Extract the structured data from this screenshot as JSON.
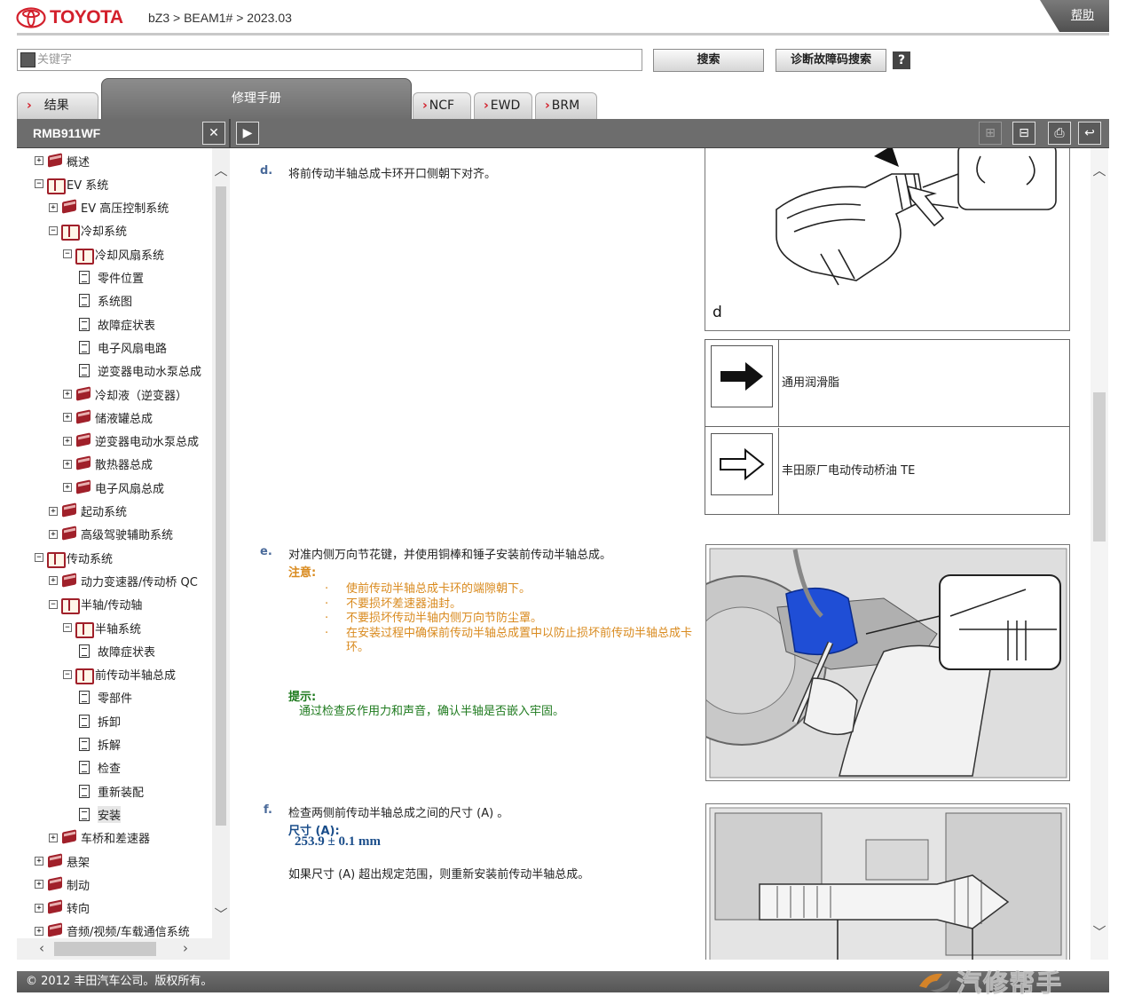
{
  "header": {
    "brand": "TOYOTA",
    "breadcrumb": "bZ3 > BEAM1# > 2023.03",
    "help_label": "帮助"
  },
  "search": {
    "placeholder": "关键字",
    "search_button": "搜索",
    "dtc_button": "诊断故障码搜索",
    "help_icon": "?"
  },
  "tabs": [
    {
      "label": "结果"
    },
    {
      "label": "修理手册"
    },
    {
      "label": "NCF"
    },
    {
      "label": "EWD"
    },
    {
      "label": "BRM"
    }
  ],
  "toolbar": {
    "doc_id": "RMB911WF"
  },
  "tree": [
    {
      "label": "概述",
      "level": 0,
      "type": "book",
      "expanded": false
    },
    {
      "label": "EV 系统",
      "level": 0,
      "type": "book-open",
      "expanded": true
    },
    {
      "label": "EV 高压控制系统",
      "level": 1,
      "type": "book",
      "expanded": false
    },
    {
      "label": "冷却系统",
      "level": 1,
      "type": "book-open",
      "expanded": true
    },
    {
      "label": "冷却风扇系统",
      "level": 2,
      "type": "book-open",
      "expanded": true
    },
    {
      "label": "零件位置",
      "level": 3,
      "type": "page"
    },
    {
      "label": "系统图",
      "level": 3,
      "type": "page"
    },
    {
      "label": "故障症状表",
      "level": 3,
      "type": "page"
    },
    {
      "label": "电子风扇电路",
      "level": 3,
      "type": "page"
    },
    {
      "label": "逆变器电动水泵总成",
      "level": 3,
      "type": "page"
    },
    {
      "label": "冷却液（逆变器）",
      "level": 2,
      "type": "book",
      "expanded": false
    },
    {
      "label": "储液罐总成",
      "level": 2,
      "type": "book",
      "expanded": false
    },
    {
      "label": "逆变器电动水泵总成",
      "level": 2,
      "type": "book",
      "expanded": false
    },
    {
      "label": "散热器总成",
      "level": 2,
      "type": "book",
      "expanded": false
    },
    {
      "label": "电子风扇总成",
      "level": 2,
      "type": "book",
      "expanded": false
    },
    {
      "label": "起动系统",
      "level": 1,
      "type": "book",
      "expanded": false
    },
    {
      "label": "高级驾驶辅助系统",
      "level": 1,
      "type": "book",
      "expanded": false
    },
    {
      "label": "传动系统",
      "level": 0,
      "type": "book-open",
      "expanded": true
    },
    {
      "label": "动力变速器/传动桥 QC",
      "level": 1,
      "type": "book",
      "expanded": false
    },
    {
      "label": "半轴/传动轴",
      "level": 1,
      "type": "book-open",
      "expanded": true
    },
    {
      "label": "半轴系统",
      "level": 2,
      "type": "book-open",
      "expanded": true
    },
    {
      "label": "故障症状表",
      "level": 3,
      "type": "page"
    },
    {
      "label": "前传动半轴总成",
      "level": 2,
      "type": "book-open",
      "expanded": true
    },
    {
      "label": "零部件",
      "level": 3,
      "type": "page"
    },
    {
      "label": "拆卸",
      "level": 3,
      "type": "page"
    },
    {
      "label": "拆解",
      "level": 3,
      "type": "page"
    },
    {
      "label": "检查",
      "level": 3,
      "type": "page"
    },
    {
      "label": "重新装配",
      "level": 3,
      "type": "page"
    },
    {
      "label": "安装",
      "level": 3,
      "type": "page",
      "selected": true
    },
    {
      "label": "车桥和差速器",
      "level": 1,
      "type": "book",
      "expanded": false
    },
    {
      "label": "悬架",
      "level": 0,
      "type": "book",
      "expanded": false
    },
    {
      "label": "制动",
      "level": 0,
      "type": "book",
      "expanded": false
    },
    {
      "label": "转向",
      "level": 0,
      "type": "book",
      "expanded": false
    },
    {
      "label": "音频/视频/车载通信系统",
      "level": 0,
      "type": "book",
      "expanded": false
    }
  ],
  "content": {
    "step_d": {
      "letter": "d.",
      "text": "将前传动半轴总成卡环开口侧朝下对齐。"
    },
    "figure_d_label": "d",
    "legend": [
      {
        "icon": "solid-arrow-icon",
        "text": "通用润滑脂"
      },
      {
        "icon": "outline-arrow-icon",
        "text": "丰田原厂电动传动桥油 TE"
      }
    ],
    "step_e": {
      "letter": "e.",
      "text": "对准内侧万向节花键，并使用铜棒和锤子安装前传动半轴总成。",
      "caution_title": "注意:",
      "cautions": [
        "使前传动半轴总成卡环的端隙朝下。",
        "不要损坏差速器油封。",
        "不要损坏传动半轴内侧万向节防尘罩。",
        "在安装过程中确保前传动半轴总成置中以防止损坏前传动半轴总成卡环。"
      ],
      "bullet": "·",
      "hint_title": "提示:",
      "hint_text": "通过检查反作用力和声音，确认半轴是否嵌入牢固。"
    },
    "step_f": {
      "letter": "f.",
      "text": "检查两侧前传动半轴总成之间的尺寸 (A) 。",
      "spec_label": "尺寸 (A):",
      "spec_value": "253.9 ± 0.1 mm",
      "followup": "如果尺寸 (A) 超出规定范围，则重新安装前传动半轴总成。"
    }
  },
  "footer": {
    "copyright": "© 2012 丰田汽车公司。版权所有。"
  },
  "watermark": {
    "text": "汽修帮手"
  },
  "colors": {
    "brand_red": "#d3202c",
    "toolbar_gray": "#6d6d6d",
    "caution_orange": "#d98a1e",
    "hint_green": "#1e7a1e",
    "spec_blue": "#1a4d8a"
  }
}
